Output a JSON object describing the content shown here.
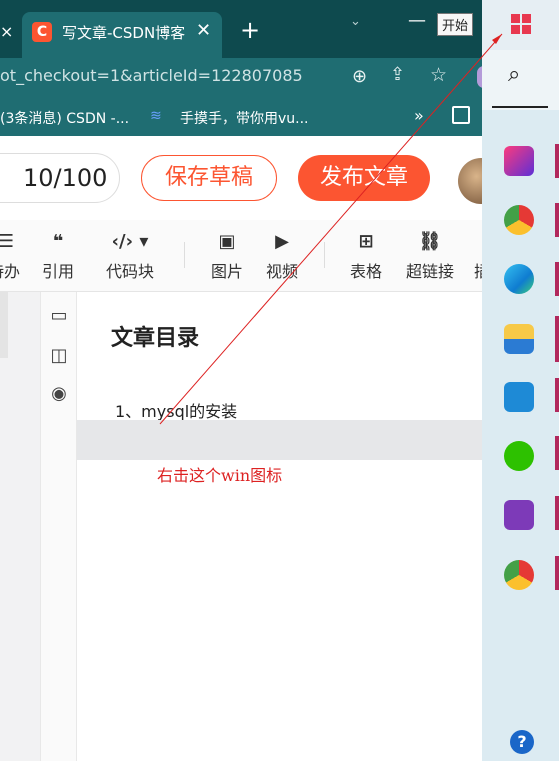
{
  "browser": {
    "tab_close_left": "×",
    "active_tab": {
      "title": "写文章-CSDN博客",
      "close": "✕"
    },
    "new_tab": "+",
    "tab_dropdown": "⌄",
    "minimize": "—",
    "url": "ot_checkout=1&articleId=122807085",
    "bookmarks": [
      {
        "label": "(3条消息) CSDN -..."
      },
      {
        "label": "手摸手，带你用vu..."
      }
    ],
    "bookmarks_more": "»"
  },
  "editor": {
    "word_count": "10/100",
    "save_draft": "保存草稿",
    "publish": "发布文章",
    "toolbar": [
      {
        "icon": "☰",
        "label": "待办"
      },
      {
        "icon": "❝",
        "label": "引用"
      },
      {
        "icon": "‹/› ▾",
        "label": "代码块"
      },
      {
        "icon": "▣",
        "label": "图片"
      },
      {
        "icon": "▶",
        "label": "视频"
      },
      {
        "icon": "⊞",
        "label": "表格"
      },
      {
        "icon": "⛓",
        "label": "超链接"
      },
      {
        "icon": "",
        "label": "插"
      }
    ],
    "toc_title": "文章目录",
    "toc_items": [
      "1、mysql的安装"
    ]
  },
  "annotation": "右击这个win图标",
  "tooltip": "开始",
  "taskbar": {
    "apps": [
      "intellij-icon",
      "chrome-profile-icon",
      "edge-icon",
      "file-explorer-icon",
      "vscode-icon",
      "wechat-icon",
      "onenote-icon",
      "chrome-icon"
    ]
  },
  "colors": {
    "brand": "#fc5531",
    "chrome_dark": "#0e4a4e",
    "chrome": "#1f6d72",
    "annotation": "#dd2222"
  }
}
